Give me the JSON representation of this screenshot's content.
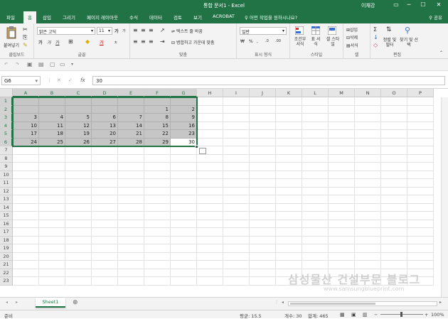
{
  "window": {
    "title": "통합 문서1  -  Excel",
    "user": "이채강",
    "controls": [
      "▭",
      "─",
      "☐",
      "✕"
    ]
  },
  "tabs": [
    "파일",
    "홈",
    "삽입",
    "그리기",
    "페이지 레이아웃",
    "수식",
    "데이터",
    "검토",
    "보기",
    "ACROBAT"
  ],
  "tell_me": "어떤 작업을 원하시나요?",
  "share": "공유",
  "ribbon": {
    "clipboard": {
      "paste": "붙여넣기",
      "label": "클립보드"
    },
    "font": {
      "name": "맑은 고딕",
      "size": "11",
      "bold": "가",
      "italic": "가",
      "underline": "가",
      "grow": "가",
      "shrink": "가",
      "color_letter": "가",
      "label": "글꼴"
    },
    "align": {
      "wrap": "텍스트 줄 바꿈",
      "merge": "병합하고 가운데 맞춤",
      "label": "맞춤"
    },
    "number": {
      "format": "일반",
      "label": "표시 형식"
    },
    "style": {
      "conditional": "조건부 서식",
      "table": "표 서식",
      "cell": "셀 스타일",
      "label": "스타일"
    },
    "cells": {
      "insert": "삽입",
      "delete": "삭제",
      "format": "서식",
      "label": "셀"
    },
    "editing": {
      "sort": "정렬 및 필터",
      "find": "찾기 및 선택",
      "label": "편집"
    }
  },
  "formula_bar": {
    "name_box": "G6",
    "fx": "fx",
    "value": "30"
  },
  "columns": [
    "A",
    "B",
    "C",
    "D",
    "E",
    "F",
    "G",
    "H",
    "I",
    "J",
    "K",
    "L",
    "M",
    "N",
    "O",
    "P"
  ],
  "rows": [
    "1",
    "2",
    "3",
    "4",
    "5",
    "6",
    "7",
    "8",
    "9",
    "10",
    "11",
    "12",
    "13",
    "14",
    "15",
    "16",
    "17",
    "18",
    "19",
    "20",
    "21",
    "22",
    "23"
  ],
  "cells": [
    [
      "",
      "",
      "",
      "",
      "",
      "",
      ""
    ],
    [
      "",
      "",
      "",
      "",
      "",
      "1",
      "2"
    ],
    [
      "3",
      "4",
      "5",
      "6",
      "7",
      "8",
      "9"
    ],
    [
      "10",
      "11",
      "12",
      "13",
      "14",
      "15",
      "16"
    ],
    [
      "17",
      "18",
      "19",
      "20",
      "21",
      "22",
      "23"
    ],
    [
      "24",
      "25",
      "26",
      "27",
      "28",
      "29",
      "30"
    ]
  ],
  "sheet_tab": "Sheet1",
  "status": {
    "mode": "준비",
    "average": "평균: 15.5",
    "count": "개수: 30",
    "sum": "합계: 465",
    "zoom": "100%"
  },
  "watermark": {
    "main": "삼성물산 건설부문 블로그",
    "url": "www.samsungblueprint.com"
  },
  "colors": {
    "accent": "#217346",
    "selection": "#c6c6c6"
  }
}
